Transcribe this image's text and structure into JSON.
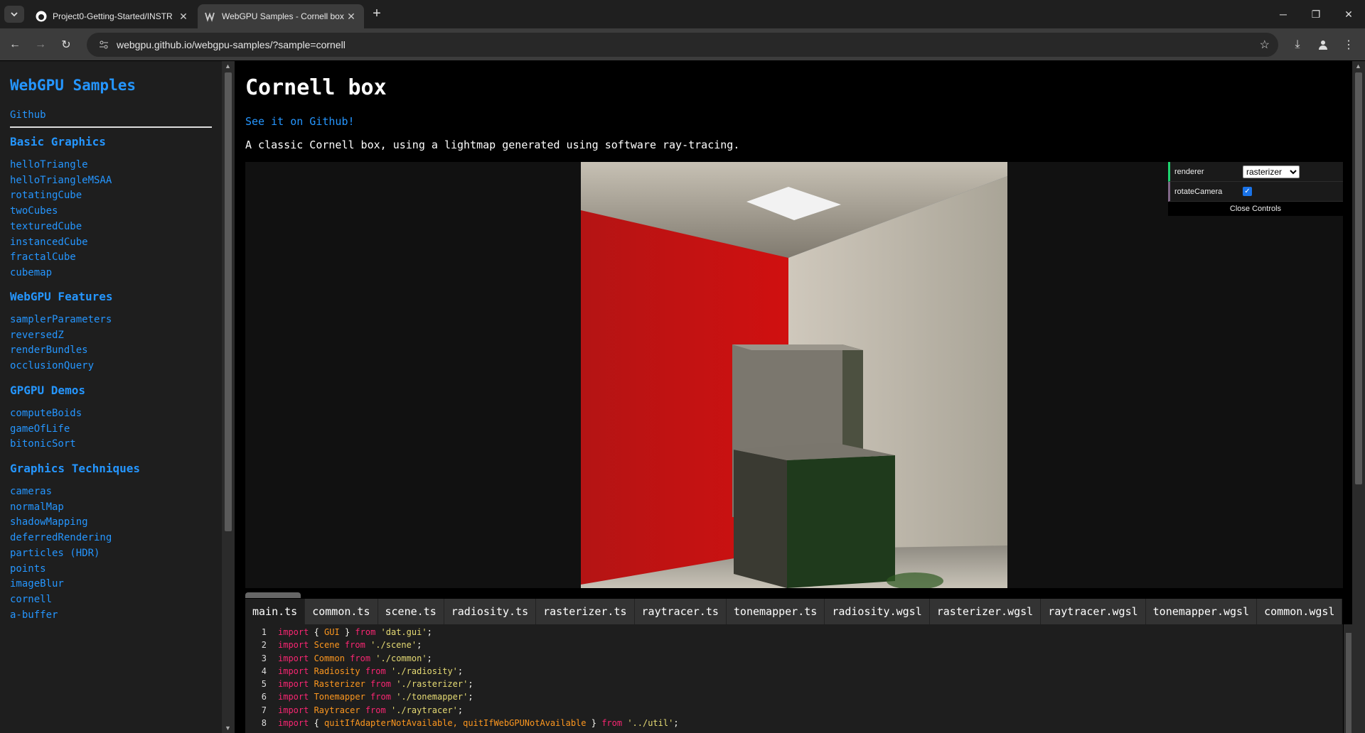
{
  "browser": {
    "tabs": [
      {
        "title": "Project0-Getting-Started/INSTR",
        "active": false,
        "icon": "github-icon"
      },
      {
        "title": "WebGPU Samples - Cornell box",
        "active": true,
        "icon": "webgpu-icon"
      }
    ],
    "url": "webgpu.github.io/webgpu-samples/?sample=cornell"
  },
  "sidebar": {
    "title": "WebGPU Samples",
    "github": "Github",
    "sections": [
      {
        "title": "Basic Graphics",
        "items": [
          "helloTriangle",
          "helloTriangleMSAA",
          "rotatingCube",
          "twoCubes",
          "texturedCube",
          "instancedCube",
          "fractalCube",
          "cubemap"
        ]
      },
      {
        "title": "WebGPU Features",
        "items": [
          "samplerParameters",
          "reversedZ",
          "renderBundles",
          "occlusionQuery"
        ]
      },
      {
        "title": "GPGPU Demos",
        "items": [
          "computeBoids",
          "gameOfLife",
          "bitonicSort"
        ]
      },
      {
        "title": "Graphics Techniques",
        "items": [
          "cameras",
          "normalMap",
          "shadowMapping",
          "deferredRendering",
          "particles (HDR)",
          "points",
          "imageBlur",
          "cornell",
          "a-buffer"
        ]
      }
    ]
  },
  "main": {
    "title": "Cornell box",
    "github_link": "See it on Github!",
    "description": "A classic Cornell box, using a lightmap generated using software ray-tracing."
  },
  "gui": {
    "renderer_label": "renderer",
    "renderer_value": "rasterizer",
    "rotate_label": "rotateCamera",
    "rotate_checked": true,
    "close_label": "Close Controls"
  },
  "source_tabs": [
    "main.ts",
    "common.ts",
    "scene.ts",
    "radiosity.ts",
    "rasterizer.ts",
    "raytracer.ts",
    "tonemapper.ts",
    "radiosity.wgsl",
    "rasterizer.wgsl",
    "raytracer.wgsl",
    "tonemapper.wgsl",
    "common.wgsl"
  ],
  "code_lines": [
    {
      "n": "1",
      "parts": [
        [
          "kw",
          "import "
        ],
        [
          "pl",
          "{ "
        ],
        [
          "id",
          "GUI"
        ],
        [
          "pl",
          " } "
        ],
        [
          "kw",
          "from "
        ],
        [
          "str",
          "'dat.gui'"
        ],
        [
          "pl",
          ";"
        ]
      ]
    },
    {
      "n": "2",
      "parts": [
        [
          "kw",
          "import "
        ],
        [
          "id",
          "Scene"
        ],
        [
          "kw",
          " from "
        ],
        [
          "str",
          "'./scene'"
        ],
        [
          "pl",
          ";"
        ]
      ]
    },
    {
      "n": "3",
      "parts": [
        [
          "kw",
          "import "
        ],
        [
          "id",
          "Common"
        ],
        [
          "kw",
          " from "
        ],
        [
          "str",
          "'./common'"
        ],
        [
          "pl",
          ";"
        ]
      ]
    },
    {
      "n": "4",
      "parts": [
        [
          "kw",
          "import "
        ],
        [
          "id",
          "Radiosity"
        ],
        [
          "kw",
          " from "
        ],
        [
          "str",
          "'./radiosity'"
        ],
        [
          "pl",
          ";"
        ]
      ]
    },
    {
      "n": "5",
      "parts": [
        [
          "kw",
          "import "
        ],
        [
          "id",
          "Rasterizer"
        ],
        [
          "kw",
          " from "
        ],
        [
          "str",
          "'./rasterizer'"
        ],
        [
          "pl",
          ";"
        ]
      ]
    },
    {
      "n": "6",
      "parts": [
        [
          "kw",
          "import "
        ],
        [
          "id",
          "Tonemapper"
        ],
        [
          "kw",
          " from "
        ],
        [
          "str",
          "'./tonemapper'"
        ],
        [
          "pl",
          ";"
        ]
      ]
    },
    {
      "n": "7",
      "parts": [
        [
          "kw",
          "import "
        ],
        [
          "id",
          "Raytracer"
        ],
        [
          "kw",
          " from "
        ],
        [
          "str",
          "'./raytracer'"
        ],
        [
          "pl",
          ";"
        ]
      ]
    },
    {
      "n": "8",
      "parts": [
        [
          "kw",
          "import "
        ],
        [
          "pl",
          "{ "
        ],
        [
          "id",
          "quitIfAdapterNotAvailable, quitIfWebGPUNotAvailable"
        ],
        [
          "pl",
          " } "
        ],
        [
          "kw",
          "from "
        ],
        [
          "str",
          "'../util'"
        ],
        [
          "pl",
          ";"
        ]
      ]
    }
  ],
  "colors": {
    "link": "#2596ff",
    "keyword": "#f92672",
    "identifier": "#fd971f",
    "string": "#e6db74"
  }
}
